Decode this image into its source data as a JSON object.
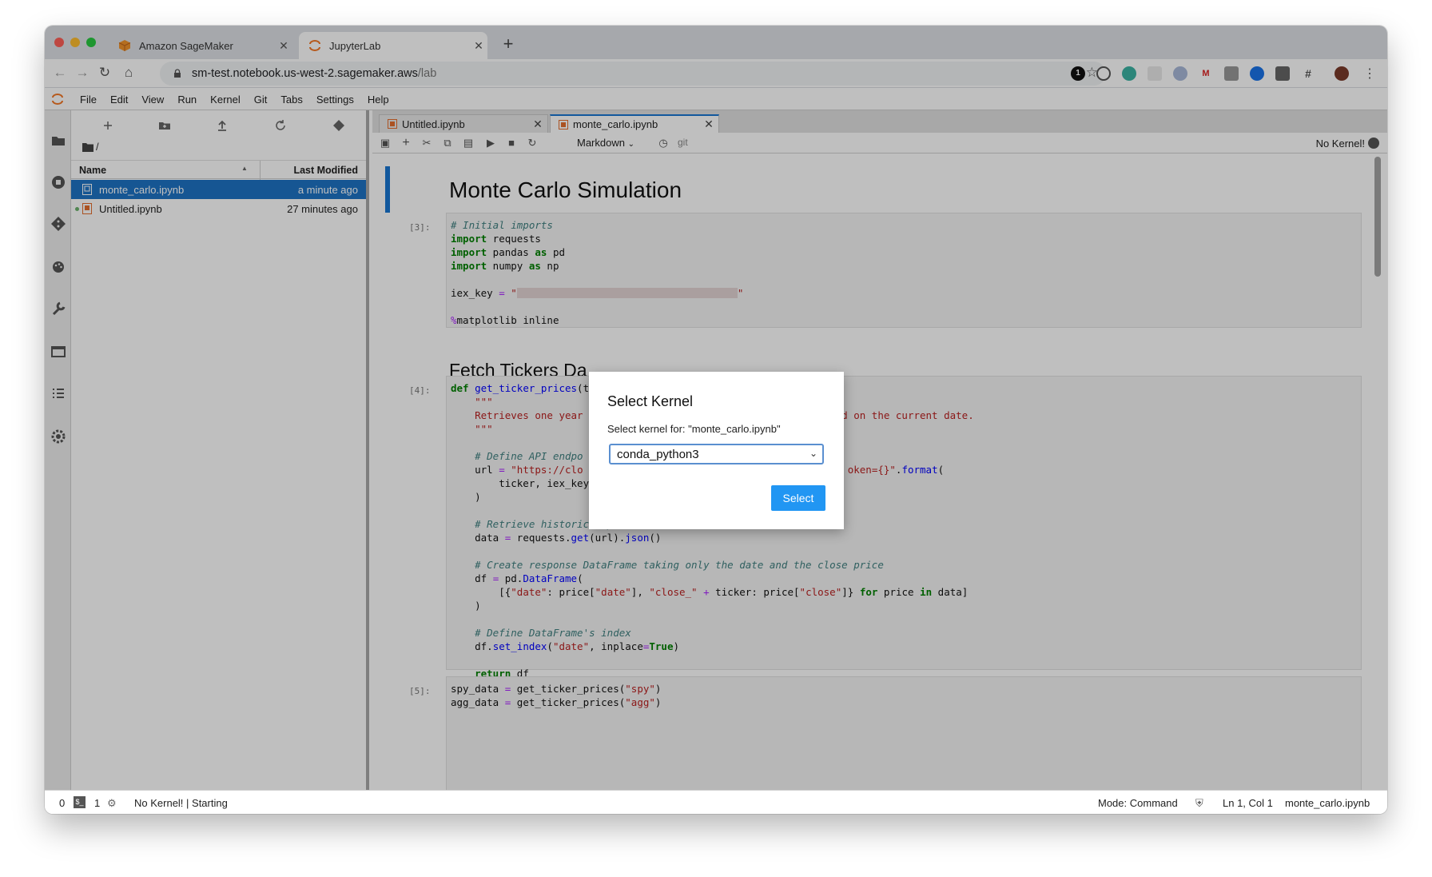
{
  "browser": {
    "tabs": [
      {
        "title": "Amazon SageMaker",
        "active": false
      },
      {
        "title": "JupyterLab",
        "active": true
      }
    ],
    "url_host": "sm-test.notebook.us-west-2.sagemaker.aws",
    "url_path": "/lab"
  },
  "jupyter": {
    "menu": [
      "File",
      "Edit",
      "View",
      "Run",
      "Kernel",
      "Git",
      "Tabs",
      "Settings",
      "Help"
    ],
    "filebrowser": {
      "breadcrumb": "/",
      "col_name": "Name",
      "col_modified": "Last Modified",
      "files": [
        {
          "name": "monte_carlo.ipynb",
          "modified": "a minute ago",
          "selected": true
        },
        {
          "name": "Untitled.ipynb",
          "modified": "27 minutes ago",
          "selected": false
        }
      ]
    },
    "doc_tabs": [
      {
        "title": "Untitled.ipynb",
        "active": false
      },
      {
        "title": "monte_carlo.ipynb",
        "active": true
      }
    ],
    "toolbar": {
      "cell_type": "Markdown",
      "git": "git",
      "kernel_status": "No Kernel!"
    },
    "notebook": {
      "heading1": "Monte Carlo Simulation",
      "heading2": "Fetch Tickers Da",
      "prompt3": "[3]:",
      "prompt4": "[4]:",
      "prompt5": "[5]:"
    },
    "statusbar": {
      "count0": "0",
      "count1": "1",
      "kernel": "No Kernel! | Starting",
      "mode": "Mode: Command",
      "position": "Ln 1, Col 1",
      "file": "monte_carlo.ipynb"
    }
  },
  "dialog": {
    "title": "Select Kernel",
    "label": "Select kernel for: \"monte_carlo.ipynb\"",
    "selected_kernel": "conda_python3",
    "button": "Select"
  },
  "colors": {
    "accent": "#1976d2",
    "selected_row": "#1e73c4",
    "dialog_button": "#2196f3"
  }
}
